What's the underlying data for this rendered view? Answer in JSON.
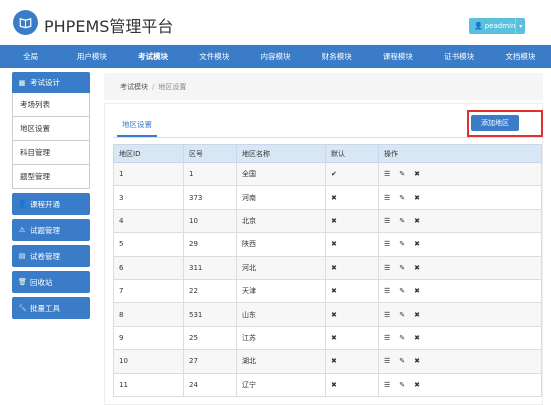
{
  "header": {
    "brand": "PHPEMS管理平台",
    "user": "peadmin"
  },
  "nav": [
    "全局",
    "用户模块",
    "考试模块",
    "文件模块",
    "内容模块",
    "财务模块",
    "课程模块",
    "证书模块",
    "文档模块"
  ],
  "sidebar": {
    "section_title": "考试设计",
    "sub_items": [
      "考场列表",
      "地区设置",
      "科目管理",
      "题型管理"
    ],
    "buttons": [
      "课程开通",
      "试题管理",
      "试卷管理",
      "回收站",
      "批量工具"
    ]
  },
  "breadcrumb": {
    "module": "考试模块",
    "sep": "/",
    "current": "地区设置"
  },
  "panel": {
    "tab": "地区设置",
    "add_button": "添加地区"
  },
  "table": {
    "headers": [
      "地区ID",
      "区号",
      "地区名称",
      "默认",
      "操作"
    ],
    "rows": [
      {
        "id": "1",
        "code": "1",
        "name": "全国",
        "default": "✔"
      },
      {
        "id": "3",
        "code": "373",
        "name": "河南",
        "default": "✖"
      },
      {
        "id": "4",
        "code": "10",
        "name": "北京",
        "default": "✖"
      },
      {
        "id": "5",
        "code": "29",
        "name": "陕西",
        "default": "✖"
      },
      {
        "id": "6",
        "code": "311",
        "name": "河北",
        "default": "✖"
      },
      {
        "id": "7",
        "code": "22",
        "name": "天津",
        "default": "✖"
      },
      {
        "id": "8",
        "code": "531",
        "name": "山东",
        "default": "✖"
      },
      {
        "id": "9",
        "code": "25",
        "name": "江苏",
        "default": "✖"
      },
      {
        "id": "10",
        "code": "27",
        "name": "湖北",
        "default": "✖"
      },
      {
        "id": "11",
        "code": "24",
        "name": "辽宁",
        "default": "✖"
      }
    ]
  },
  "colors": {
    "primary": "#3a7cc7",
    "info": "#5bc0de",
    "highlight": "#e03030"
  }
}
